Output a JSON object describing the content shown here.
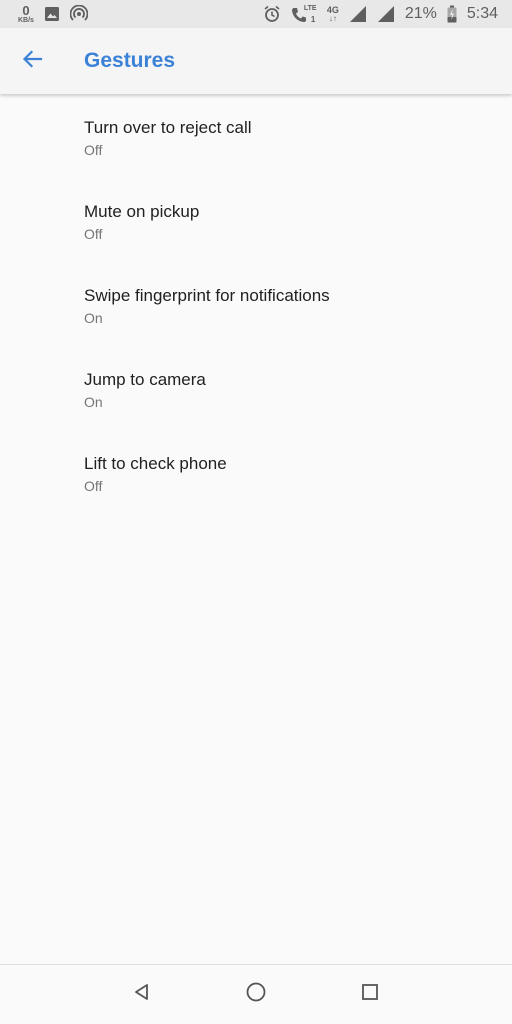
{
  "status_bar": {
    "speed_value": "0",
    "speed_unit": "KB/s",
    "network_lte": "LTE",
    "network_sim": "1",
    "network_4g": "4G",
    "battery_percent": "21%",
    "time": "5:34",
    "icons": [
      "image-icon",
      "hotspot-icon",
      "alarm-icon",
      "volte-call-icon",
      "signal-icon",
      "signal-icon",
      "battery-icon"
    ]
  },
  "app_bar": {
    "back_icon": "arrow-back-icon",
    "title": "Gestures",
    "accent_color": "#3b82d6"
  },
  "gestures": [
    {
      "title": "Turn over to reject call",
      "summary": "Off"
    },
    {
      "title": "Mute on pickup",
      "summary": "Off"
    },
    {
      "title": "Swipe fingerprint for notifications",
      "summary": "On"
    },
    {
      "title": "Jump to camera",
      "summary": "On"
    },
    {
      "title": "Lift to check phone",
      "summary": "Off"
    }
  ],
  "nav_bar": {
    "icons": [
      "back-triangle-icon",
      "home-circle-icon",
      "recents-square-icon"
    ]
  }
}
